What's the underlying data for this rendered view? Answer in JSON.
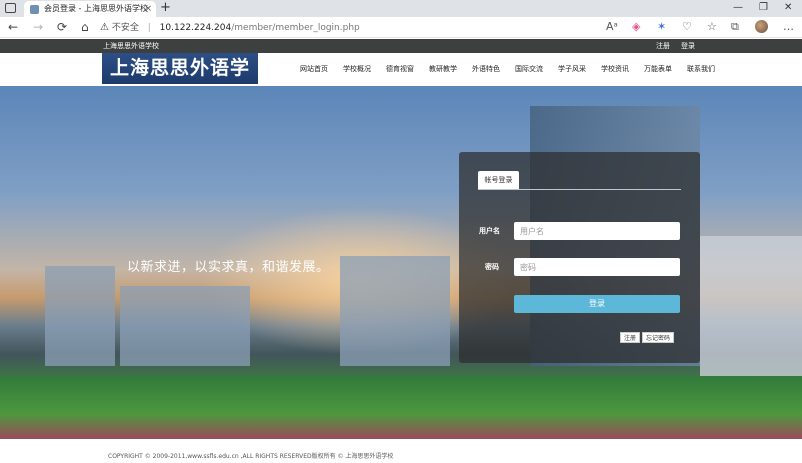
{
  "browser": {
    "tab_title": "会员登录 - 上海思思外语学校",
    "new_tab": "+",
    "close_tab": "×",
    "address": {
      "warning_icon": "warning-triangle-icon",
      "insecure_label": "不安全",
      "separator": "|",
      "host": "10.122.224.204",
      "path": "/member/member_login.php"
    },
    "window_controls": {
      "minimize": "—",
      "restore": "❐",
      "close": "✕"
    },
    "nav": {
      "back": "←",
      "forward": "→",
      "reload": "⟳",
      "home": "⌂"
    },
    "toolbar_icons": [
      "read-aloud-icon",
      "favorite-star-icon",
      "extension-icon",
      "browser-essentials-icon",
      "collections-icon",
      "favorites-icon",
      "profile-avatar"
    ]
  },
  "site": {
    "top_strip": {
      "site_name": "上海思思外语学校",
      "register": "注册",
      "login": "登录"
    },
    "logo_text": "上海思思外语学校",
    "nav": [
      "网站首页",
      "学校概况",
      "德育视窗",
      "教研教学",
      "外语特色",
      "国际交流",
      "学子风采",
      "学校资讯",
      "万能表单",
      "联系我们"
    ],
    "slogan": "以新求进，以实求真，和谐发展。",
    "login_box": {
      "tab": "帐号登录",
      "username_label": "用户名",
      "username_placeholder": "用户名",
      "password_label": "密码",
      "password_placeholder": "密码",
      "submit": "登录",
      "register": "注册",
      "forgot": "忘记密码"
    },
    "footer": {
      "copyright": "COPYRIGHT © 2009-2011,www.ssfls.edu.cn ,ALL RIGHTS RESERVED版权所有 © 上海思思外语学校"
    }
  }
}
